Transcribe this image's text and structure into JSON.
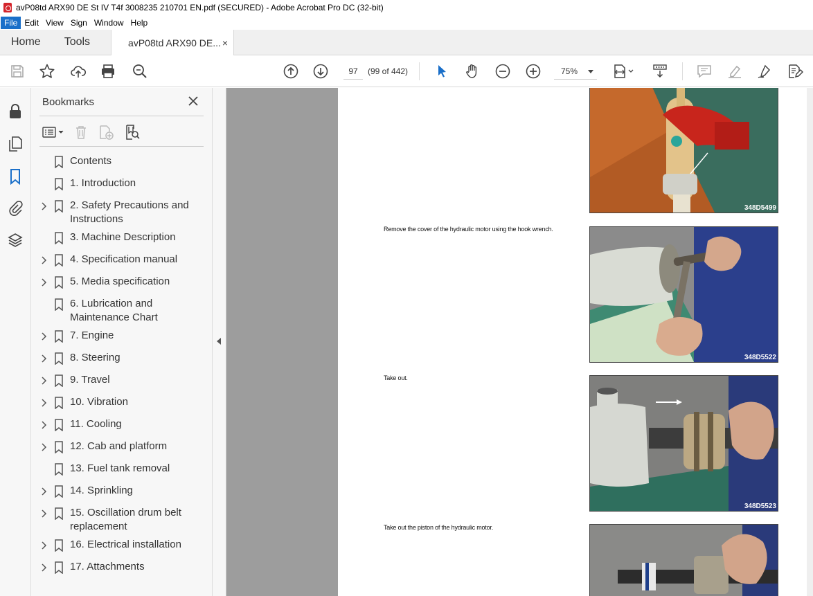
{
  "window": {
    "title": "avP08td ARX90 DE St IV T4f 3008235 210701 EN.pdf (SECURED) - Adobe Acrobat Pro DC (32-bit)"
  },
  "menu": [
    "File",
    "Edit",
    "View",
    "Sign",
    "Window",
    "Help"
  ],
  "tabs": {
    "home": "Home",
    "tools": "Tools",
    "document": "avP08td ARX90 DE...",
    "close": "×"
  },
  "toolbar": {
    "page_number": "97",
    "page_of": "(99 of 442)",
    "zoom": "75%"
  },
  "bookmarks": {
    "title": "Bookmarks",
    "items": [
      {
        "label": "Contents",
        "expandable": false
      },
      {
        "label": "1. Introduction",
        "expandable": false
      },
      {
        "label": "2. Safety Precautions and Instructions",
        "expandable": true
      },
      {
        "label": "3. Machine Description",
        "expandable": false
      },
      {
        "label": "4. Specification manual",
        "expandable": true
      },
      {
        "label": "5. Media specification",
        "expandable": true
      },
      {
        "label": "6. Lubrication and Maintenance Chart",
        "expandable": false
      },
      {
        "label": "7. Engine",
        "expandable": true
      },
      {
        "label": "8. Steering",
        "expandable": true
      },
      {
        "label": "9. Travel",
        "expandable": true
      },
      {
        "label": "10. Vibration",
        "expandable": true
      },
      {
        "label": "11. Cooling",
        "expandable": true
      },
      {
        "label": "12. Cab and platform",
        "expandable": true
      },
      {
        "label": "13. Fuel tank removal",
        "expandable": false
      },
      {
        "label": "14. Sprinkling",
        "expandable": true
      },
      {
        "label": "15. Oscillation drum belt replacement",
        "expandable": true
      },
      {
        "label": "16. Electrical installation",
        "expandable": true
      },
      {
        "label": "17. Attachments",
        "expandable": true
      }
    ]
  },
  "document": {
    "steps": [
      {
        "caption": "",
        "photo_code": "348D5499"
      },
      {
        "caption": "Remove the cover of the hydraulic motor using the hook wrench.",
        "photo_code": "348D5522"
      },
      {
        "caption": "Take out.",
        "photo_code": "348D5523"
      },
      {
        "caption": "Take out the piston of the hydraulic motor.",
        "photo_code": ""
      }
    ]
  },
  "colors": {
    "accent": "#1a6fc9",
    "viewer_bg": "#9d9d9d"
  }
}
